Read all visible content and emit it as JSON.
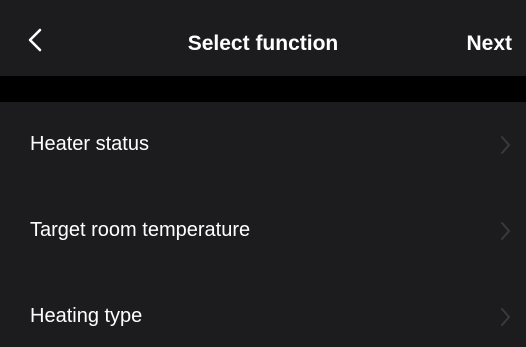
{
  "navbar": {
    "back_icon": "chevron-left-icon",
    "title": "Select function",
    "next_label": "Next"
  },
  "functions": [
    {
      "label": "Heater status",
      "icon": "chevron-right-icon"
    },
    {
      "label": "Target room temperature",
      "icon": "chevron-right-icon"
    },
    {
      "label": "Heating type",
      "icon": "chevron-right-icon"
    }
  ],
  "colors": {
    "background": "#1c1c1e",
    "section_gap": "#000000",
    "text": "#ffffff",
    "chevron": "#3a3a3c"
  }
}
